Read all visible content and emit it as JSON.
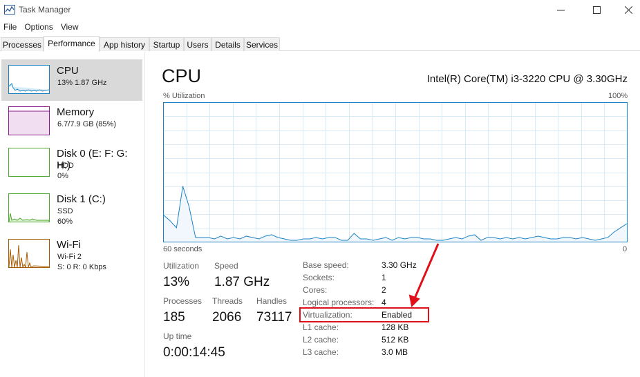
{
  "window": {
    "title": "Task Manager",
    "menu": [
      "File",
      "Options",
      "View"
    ]
  },
  "tabs": [
    "Processes",
    "Performance",
    "App history",
    "Startup",
    "Users",
    "Details",
    "Services"
  ],
  "active_tab": "Performance",
  "sidebar": {
    "items": [
      {
        "title": "CPU",
        "lines": [
          "13%  1.87 GHz"
        ],
        "color": "#1a82c4",
        "selected": true
      },
      {
        "title": "Memory",
        "lines": [
          "6.7/7.9 GB (85%)"
        ],
        "color": "#8b1a8b",
        "selected": false
      },
      {
        "title": "Disk 0 (E: F: G: H:)",
        "lines": [
          "HDD",
          "0%"
        ],
        "color": "#4ea72e",
        "selected": false
      },
      {
        "title": "Disk 1 (C:)",
        "lines": [
          "SSD",
          "60%"
        ],
        "color": "#4ea72e",
        "selected": false
      },
      {
        "title": "Wi-Fi",
        "lines": [
          "Wi-Fi 2",
          "S: 0  R: 0 Kbps"
        ],
        "color": "#a75b00",
        "selected": false
      }
    ]
  },
  "main": {
    "title": "CPU",
    "processor": "Intel(R) Core(TM) i3-3220 CPU @ 3.30GHz",
    "graph_label_left": "% Utilization",
    "graph_label_right": "100%",
    "graph_time_left": "60 seconds",
    "graph_time_right": "0",
    "graph_color": "#1a82c4",
    "utilization_series": [
      19,
      15,
      10,
      40,
      25,
      3,
      3,
      3,
      2,
      4,
      2,
      3,
      2,
      4,
      3,
      2,
      4,
      5,
      3,
      2,
      1,
      1,
      2,
      2,
      3,
      2,
      3,
      3,
      1,
      1,
      6,
      2,
      2,
      1,
      2,
      3,
      1,
      3,
      2,
      3,
      3,
      2,
      2,
      1,
      1,
      2,
      3,
      2,
      4,
      5,
      1,
      3,
      3,
      2,
      3,
      2,
      3,
      2,
      3,
      4,
      3,
      2,
      2,
      3,
      3,
      2,
      3,
      2,
      1,
      2,
      3,
      7,
      10,
      13
    ]
  },
  "stats": {
    "utilization_label": "Utilization",
    "utilization": "13%",
    "speed_label": "Speed",
    "speed": "1.87 GHz",
    "processes_label": "Processes",
    "processes": "185",
    "threads_label": "Threads",
    "threads": "2066",
    "handles_label": "Handles",
    "handles": "73117",
    "uptime_label": "Up time",
    "uptime": "0:00:14:45"
  },
  "specs": [
    {
      "label": "Base speed:",
      "value": "3.30 GHz"
    },
    {
      "label": "Sockets:",
      "value": "1"
    },
    {
      "label": "Cores:",
      "value": "2"
    },
    {
      "label": "Logical processors:",
      "value": "4"
    },
    {
      "label": "Virtualization:",
      "value": "Enabled"
    },
    {
      "label": "L1 cache:",
      "value": "128 KB"
    },
    {
      "label": "L2 cache:",
      "value": "512 KB"
    },
    {
      "label": "L3 cache:",
      "value": "3.0 MB"
    }
  ],
  "annotation_color": "#e0101a"
}
